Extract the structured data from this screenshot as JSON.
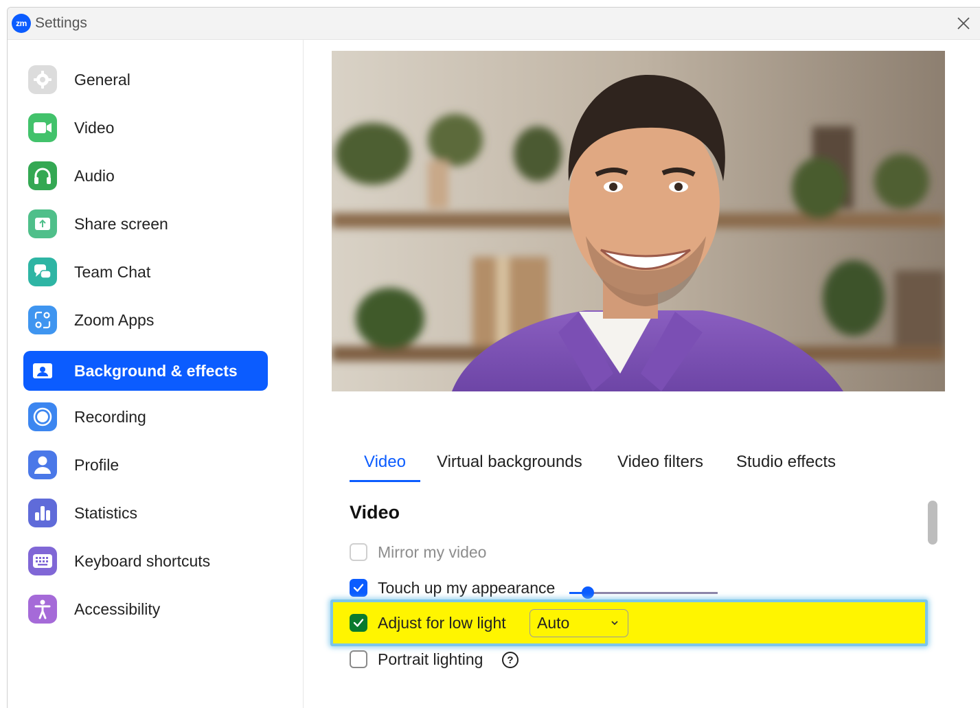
{
  "window": {
    "title": "Settings",
    "logo_text": "zm"
  },
  "sidebar": {
    "items": [
      {
        "label": "General",
        "icon": "gear-icon",
        "color": "#d9d9d9"
      },
      {
        "label": "Video",
        "icon": "video-camera-icon",
        "color": "#42c26b"
      },
      {
        "label": "Audio",
        "icon": "headphones-icon",
        "color": "#34a853"
      },
      {
        "label": "Share screen",
        "icon": "share-screen-icon",
        "color": "#4fbf8a"
      },
      {
        "label": "Team Chat",
        "icon": "chat-bubbles-icon",
        "color": "#2eb5a4"
      },
      {
        "label": "Zoom Apps",
        "icon": "apps-icon",
        "color": "#3f95f0"
      },
      {
        "label": "Background & effects",
        "icon": "background-portrait-icon",
        "color": "#0b5cff",
        "active": true
      },
      {
        "label": "Recording",
        "icon": "record-circle-icon",
        "color": "#3c86f0"
      },
      {
        "label": "Profile",
        "icon": "user-icon",
        "color": "#4a78e8"
      },
      {
        "label": "Statistics",
        "icon": "bar-chart-icon",
        "color": "#5f6bd9"
      },
      {
        "label": "Keyboard shortcuts",
        "icon": "keyboard-icon",
        "color": "#8067d6"
      },
      {
        "label": "Accessibility",
        "icon": "accessibility-icon",
        "color": "#a56ad8"
      }
    ]
  },
  "tabs": [
    {
      "label": "Video",
      "active": true
    },
    {
      "label": "Virtual backgrounds"
    },
    {
      "label": "Video filters"
    },
    {
      "label": "Studio effects"
    }
  ],
  "video_section": {
    "title": "Video",
    "mirror_label": "Mirror my video",
    "mirror_checked": false,
    "touch_up_label": "Touch up my appearance",
    "touch_up_checked": true,
    "touch_up_level": 0.12,
    "low_light_label": "Adjust for low light",
    "low_light_checked": true,
    "low_light_mode": "Auto",
    "portrait_label": "Portrait lighting",
    "portrait_checked": false
  },
  "colors": {
    "accent": "#0b5cff",
    "highlight": "#fff500",
    "highlight_border": "#7cc6ea"
  }
}
